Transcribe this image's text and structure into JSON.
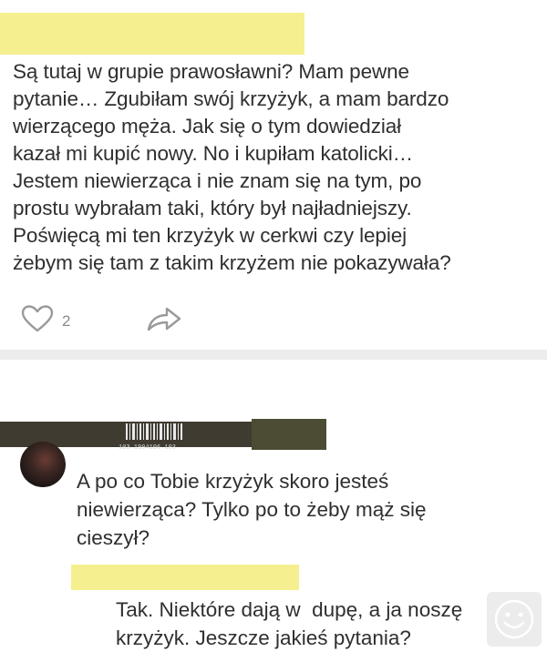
{
  "post": {
    "text": "Są tutaj w grupie prawosławni? Mam pewne\npytanie… Zgubiłam swój krzyżyk, a mam bardzo\nwierzącego męża. Jak się o tym dowiedział\nkazał mi kupić nowy. No i kupiłam katolicki…\nJestem niewierząca i nie znam się na tym, po\nprostu wybrałam taki, który był najładniejszy.\nPoświęcą mi ten krzyżyk w cerkwi czy lepiej\nżebym się tam z takim krzyżem nie pokazywała?",
    "like_count": "2",
    "like_icon": "heart-outline-icon",
    "share_icon": "share-arrow-icon"
  },
  "comment": {
    "barcode_caption": "103 1994106 103",
    "text": "A po co Tobie krzyżyk skoro jesteś\nniewierząca? Tylko po to żeby mąż się\ncieszył?"
  },
  "reply": {
    "text": "Tak. Niektóre dają w  dupę, a ja noszę\nkrzyżyk. Jeszcze jakieś pytania?"
  },
  "colors": {
    "redaction_yellow": "#f6ef8f",
    "redaction_dark": "#3f3b31",
    "text": "#2f2f2f",
    "icon_gray": "#9a9a9a",
    "divider": "#ececec"
  }
}
